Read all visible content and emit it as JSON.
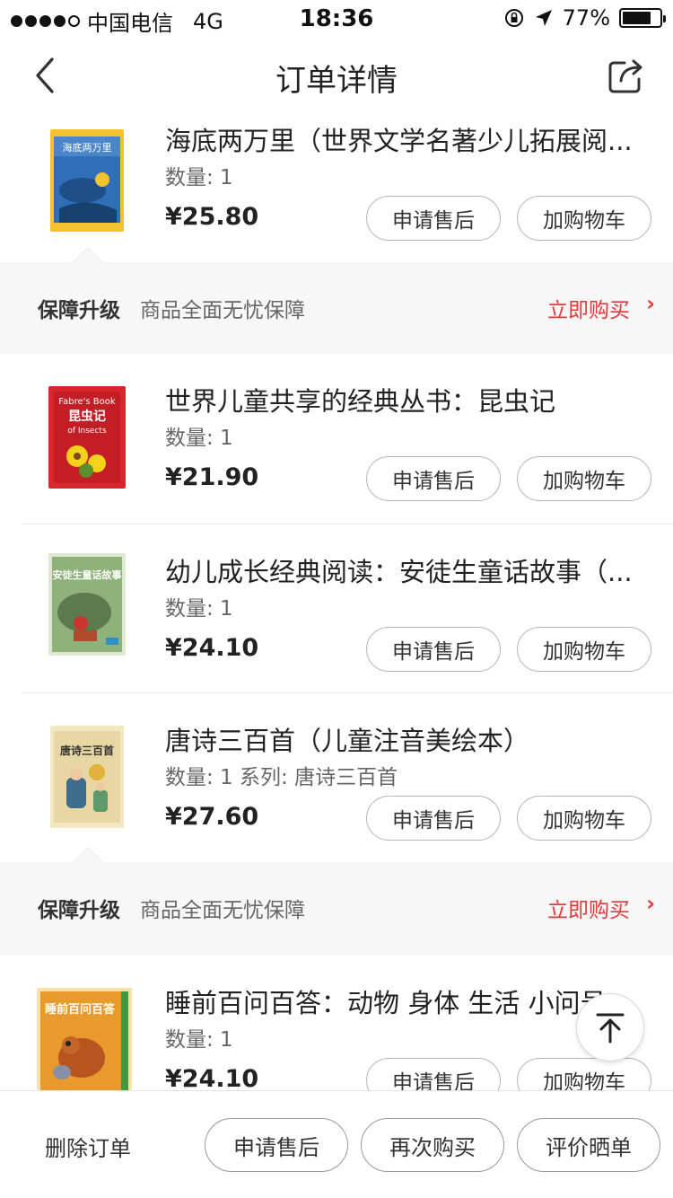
{
  "status_bar": {
    "carrier": "中国电信",
    "network": "4G",
    "time": "18:36",
    "battery": "77%",
    "battery_level": 0.77
  },
  "nav": {
    "title": "订单详情"
  },
  "products": [
    {
      "name": "海底两万里（世界文学名著少儿拓展阅...",
      "qty": "数量: 1",
      "price": "¥25.80",
      "after_sale": "申请售后",
      "add_cart": "加购物车",
      "cover_title": "海底两万里",
      "cover_color": "#2f6fb8"
    },
    {
      "name": "世界儿童共享的经典丛书：昆虫记",
      "qty": "数量: 1",
      "price": "¥21.90",
      "after_sale": "申请售后",
      "add_cart": "加购物车",
      "cover_title": "昆虫记",
      "cover_sub1": "Fabre's Book",
      "cover_sub2": "of Insects",
      "cover_color": "#d8262c"
    },
    {
      "name": "幼儿成长经典阅读：安徒生童话故事（...",
      "qty": "数量: 1",
      "price": "¥24.10",
      "after_sale": "申请售后",
      "add_cart": "加购物车",
      "cover_title": "安徒生童话故事",
      "cover_color": "#5d8a55"
    },
    {
      "name": "唐诗三百首（儿童注音美绘本）",
      "qty": "数量: 1  系列: 唐诗三百首",
      "price": "¥27.60",
      "after_sale": "申请售后",
      "add_cart": "加购物车",
      "cover_title": "唐诗三百首",
      "cover_color": "#e9d7a3"
    },
    {
      "name": "睡前百问百答：动物 身体 生活 小问号（...",
      "qty": "数量: 1",
      "price": "¥24.10",
      "after_sale": "申请售后",
      "add_cart": "加购物车",
      "cover_title": "睡前百问百答",
      "cover_color": "#e89a2c"
    }
  ],
  "guarantee": {
    "title": "保障升级",
    "desc": "商品全面无忧保障",
    "buy": "立即购买",
    "arrow": "›"
  },
  "footer": {
    "delete": "删除订单",
    "after_sale": "申请售后",
    "rebuy": "再次购买",
    "review": "评价晒单"
  },
  "colors": {
    "accent": "#e4393c",
    "divider": "#ececec",
    "band": "#f7f7f7"
  }
}
